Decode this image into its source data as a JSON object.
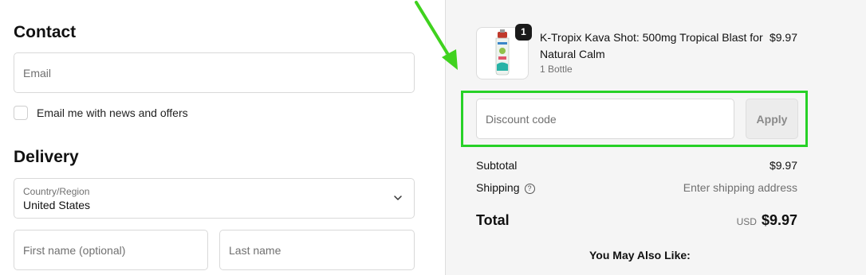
{
  "contact": {
    "heading": "Contact",
    "email_placeholder": "Email",
    "newsletter_label": "Email me with news and offers"
  },
  "delivery": {
    "heading": "Delivery",
    "country_label": "Country/Region",
    "country_value": "United States",
    "first_name_placeholder": "First name (optional)",
    "last_name_placeholder": "Last name"
  },
  "summary": {
    "item": {
      "quantity": "1",
      "title": "K-Tropix Kava Shot: 500mg Tropical Blast for Natural Calm",
      "variant": "1 Bottle",
      "price": "$9.97"
    },
    "discount_placeholder": "Discount code",
    "apply_label": "Apply",
    "subtotal_label": "Subtotal",
    "subtotal_value": "$9.97",
    "shipping_label": "Shipping",
    "shipping_value": "Enter shipping address",
    "total_label": "Total",
    "total_currency": "USD",
    "total_value": "$9.97",
    "also_like": "You May Also Like:"
  },
  "colors": {
    "highlight": "#27d127",
    "summary_bg": "#f5f5f5",
    "badge": "#1a1a1a"
  },
  "icons": [
    "chevron-down-icon",
    "help-circle-icon",
    "product-bottle-image",
    "annotation-arrow-icon"
  ]
}
